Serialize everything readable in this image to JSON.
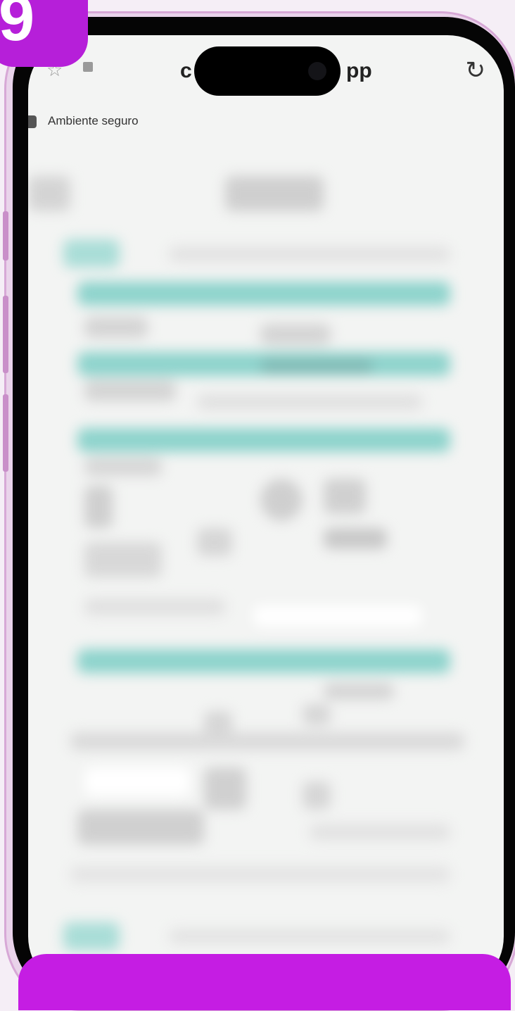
{
  "step_badge": {
    "number": "9"
  },
  "browser": {
    "url_left": "c",
    "url_right": "pp",
    "secure_label": "Ambiente seguro"
  },
  "icons": [
    "star-icon",
    "lock-icon",
    "reload-icon",
    "shield-icon"
  ],
  "colors": {
    "accent": "#b61fd9",
    "teal": "#8dd3cc",
    "screen": "#f3f4f3"
  }
}
